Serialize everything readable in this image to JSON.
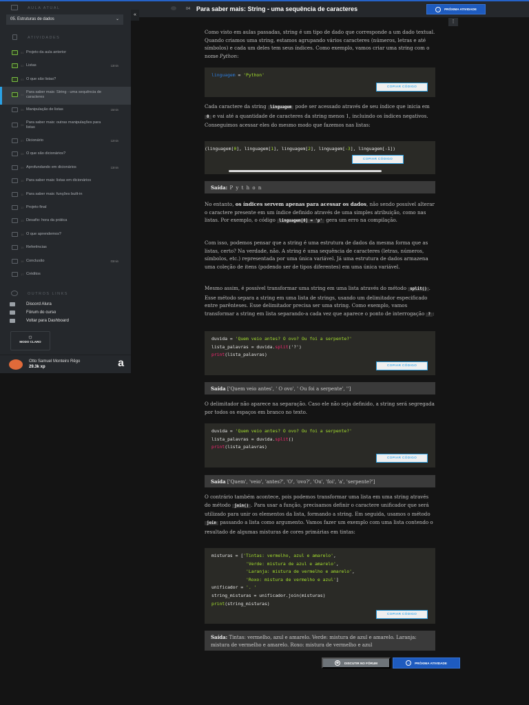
{
  "sidebar": {
    "current_section_label": "AULA ATUAL",
    "current_lesson": "05. Estruturas de dados",
    "activities_label": "ATIVIDADES",
    "items": [
      {
        "num": "01",
        "label": "Projeto da aula anterior",
        "dur": ""
      },
      {
        "num": "02",
        "label": "Listas",
        "dur": "13min"
      },
      {
        "num": "03",
        "label": "O que são listas?",
        "dur": ""
      },
      {
        "num": "04",
        "label": "Para saber mais: String - uma sequência de caracteres",
        "dur": ""
      },
      {
        "num": "05",
        "label": "Manipulação de listas",
        "dur": "15min"
      },
      {
        "num": "06",
        "label": "Para saber mais: outras manipulações para listas",
        "dur": ""
      },
      {
        "num": "07",
        "label": "Dicionário",
        "dur": "12min"
      },
      {
        "num": "08",
        "label": "O que são dicionários?",
        "dur": ""
      },
      {
        "num": "09",
        "label": "Aprofundando em dicionários",
        "dur": "13min"
      },
      {
        "num": "10",
        "label": "Para saber mais: listas em dicionários",
        "dur": ""
      },
      {
        "num": "11",
        "label": "Para saber mais: funções built-in",
        "dur": ""
      },
      {
        "num": "12",
        "label": "Projeto final",
        "dur": ""
      },
      {
        "num": "13",
        "label": "Desafio: hora da prática",
        "dur": ""
      },
      {
        "num": "14",
        "label": "O que aprendemos?",
        "dur": ""
      },
      {
        "num": "15",
        "label": "Referências",
        "dur": ""
      },
      {
        "num": "16",
        "label": "Conclusão",
        "dur": "03min"
      },
      {
        "num": "17",
        "label": "Créditos",
        "dur": ""
      }
    ],
    "other_links_label": "OUTROS LINKS",
    "links": [
      "Discord Alura",
      "Fórum do curso",
      "Voltar para Dashboard"
    ],
    "mode_button": "MODO CLARO",
    "user": {
      "name": "Otto Samuel Monteiro Rêgo",
      "xp": "29.3k xp"
    },
    "logo": "a"
  },
  "header": {
    "collapse": "«",
    "num": "04",
    "title": "Para saber mais: String - uma sequência de caracteres",
    "next": "PRÓXIMA ATIVIDADE",
    "more": "⋮"
  },
  "content": {
    "p1": [
      "Como visto em aulas passadas, string é um tipo de dado que corresponde a um dado textual. Quando criamos uma string, estamos agrupando vários caracteres (números, letras e até símbolos) e cada um deles tem seus índices. Como exemplo, vamos criar uma string com o nome ",
      "Python",
      ":"
    ],
    "code1": [
      "linguagem",
      " = ",
      "'Python'"
    ],
    "copy": "COPIAR CÓDIGO",
    "p2": [
      "Cada caractere da string ",
      "linguagem",
      " pode ser acessado através de seu índice que inicia em ",
      "0",
      " e vai até a quantidade de caracteres da string menos 1, incluindo os índices negativos. Conseguimos acessar eles do mesmo modo que fazemos nas listas:"
    ],
    "code2": [
      "(linguagem[",
      "0",
      "], linguagem[",
      "1",
      "], linguagem[",
      "2",
      "], linguagem[",
      "-3",
      "], linguagem[-1])"
    ],
    "out1": [
      "Saída:",
      " P y t h o n"
    ],
    "p3": [
      "No entanto, ",
      "os índices servem apenas para acessar os dados",
      ", não sendo possível alterar o caractere presente em um índice definido através de uma simples atribuição, como nas listas. Por exemplo, o código ",
      "linguagem[0] = 'p'",
      " gera um erro na compilação."
    ],
    "p4": "Com isso, podemos pensar que a string é uma estrutura de dados da mesma forma que as listas, certo? Na verdade, não. A string é uma sequência de caracteres (letras, números, símbolos, etc.) representada por uma única variável. Já uma estrutura de dados armazena uma coleção de itens (podendo ser de tipos diferentes) em uma única variável.",
    "p5": [
      "Mesmo assim, é possível transformar uma string em uma lista através do método ",
      "split()",
      ". Esse método separa a string em uma lista de strings, usando um delimitador especificado entre parênteses. Esse delimitador precisa ser uma string. Como exemplo, vamos transformar a string em lista separando-a cada vez que aparece o ponto de interrogação ",
      "?",
      ":"
    ],
    "code3": [
      "duvida = ",
      "'Quem veio antes? O ovo? Ou foi a serpente?'",
      "lista_palavras = duvida.",
      "split",
      "('?')",
      "print",
      "(lista_palavras)"
    ],
    "out2": [
      "Saída",
      " ['Quem veio antes', ' O ovo', ' Ou foi a serpente', '']"
    ],
    "p6": "O delimitador não aparece na separação. Caso ele não seja definido, a string será segregada por todos os espaços em branco no texto.",
    "code4": [
      "duvida = ",
      "'Quem veio antes? O ovo? Ou foi a serpente?'",
      "lista_palavras = duvida.",
      "split",
      "()",
      "print",
      "(lista_palavras)"
    ],
    "out3": [
      "Saída",
      " ['Quem', 'veio', 'antes?', 'O', 'ovo?', 'Ou', 'foi', 'a', 'serpente?']"
    ],
    "p7": [
      "O contrário também acontece, pois podemos transformar uma lista em uma string através do método ",
      "join()",
      ". Para usar a função, precisamos definir o caractere unificador que será utilizado para unir os elementos da lista, formando a string. Em seguida, usamos o método ",
      "join",
      " passando a lista como argumento. Vamos fazer um exemplo com uma lista contendo o resultado de algumas misturas de cores primárias em tintas:"
    ],
    "code5": [
      "misturas = [",
      "'Tintas: vermelho, azul e amarelo'",
      ",",
      "             ",
      "'Verde: mistura de azul e amarelo'",
      "'Laranja: mistura de vermelho e amarelo'",
      "'Roxo: mistura de vermelho e azul'",
      "]",
      "unificador = ",
      "'. '",
      "string_misturas = unificador.join(misturas)",
      "print",
      "(string_misturas)"
    ],
    "out4": [
      "Saída:",
      " Tintas: vermelho, azul e amarelo. Verde: mistura de azul e amarelo. Laranja: mistura de vermelho e amarelo. Roxo: mistura de vermelho e azul"
    ],
    "forum_button": "DISCUTIR NO FÓRUM",
    "next_button": "PRÓXIMA ATIVIDADE"
  }
}
